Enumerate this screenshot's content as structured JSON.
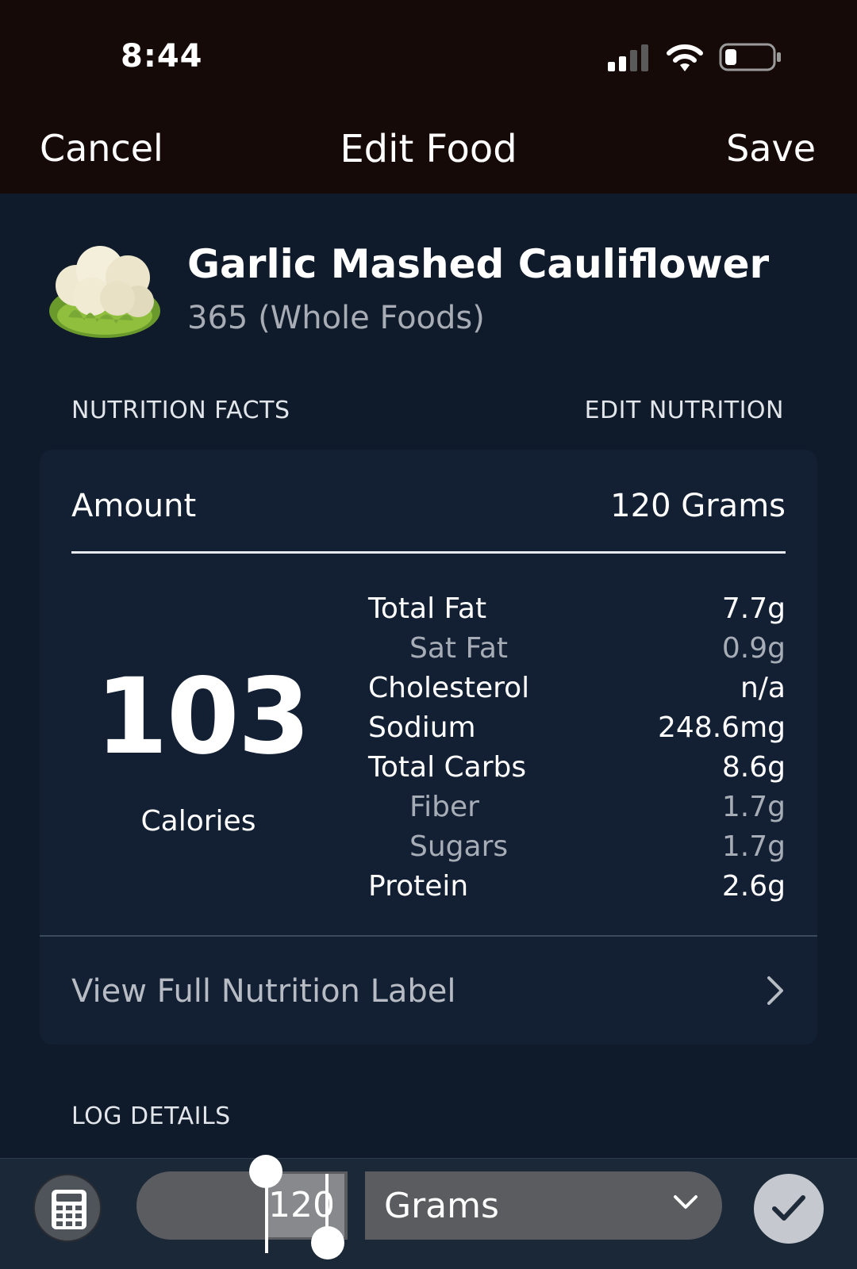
{
  "status_bar": {
    "time": "8:44"
  },
  "nav": {
    "cancel_label": "Cancel",
    "title": "Edit Food",
    "save_label": "Save"
  },
  "food": {
    "name": "Garlic Mashed Cauliflower",
    "brand": "365 (Whole Foods)",
    "image_icon": "cauliflower-icon"
  },
  "nutrition_section": {
    "header": "NUTRITION FACTS",
    "edit_label": "EDIT NUTRITION"
  },
  "amount": {
    "label": "Amount",
    "value": "120 Grams"
  },
  "calories": {
    "value": "103",
    "label": "Calories"
  },
  "nutrients": [
    {
      "name": "Total Fat",
      "value": "7.7g",
      "sub": false
    },
    {
      "name": "Sat Fat",
      "value": "0.9g",
      "sub": true
    },
    {
      "name": "Cholesterol",
      "value": "n/a",
      "sub": false
    },
    {
      "name": "Sodium",
      "value": "248.6mg",
      "sub": false
    },
    {
      "name": "Total Carbs",
      "value": "8.6g",
      "sub": false
    },
    {
      "name": "Fiber",
      "value": "1.7g",
      "sub": true
    },
    {
      "name": "Sugars",
      "value": "1.7g",
      "sub": true
    },
    {
      "name": "Protein",
      "value": "2.6g",
      "sub": false
    }
  ],
  "view_full_label": "View Full Nutrition Label",
  "log_section": {
    "header": "LOG DETAILS"
  },
  "input_bar": {
    "quantity": "120",
    "unit": "Grams",
    "calculator_icon": "calculator-icon",
    "confirm_icon": "checkmark-icon"
  },
  "colors": {
    "topbar_bg": "#150a07",
    "page_bg": "#0f1b2b",
    "card_bg": "#132033",
    "muted_text": "#a7adb6"
  }
}
